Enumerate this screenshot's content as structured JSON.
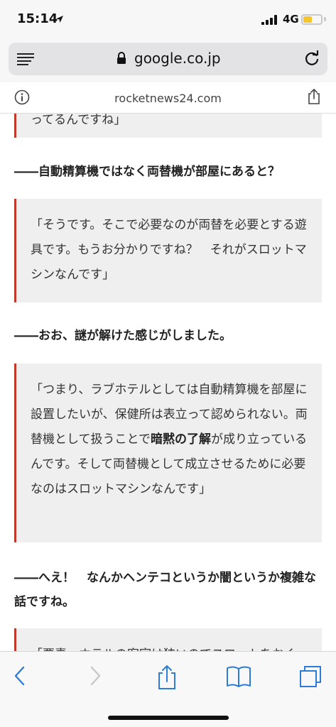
{
  "status_bar": {
    "time": "15:14",
    "network": "4G",
    "battery_level": 0.55,
    "battery_color": "#f5c52b"
  },
  "browser": {
    "url": "google.co.jp",
    "site": "rocketnews24.com",
    "icons": [
      "menu-icon",
      "lock-icon",
      "reload-icon",
      "info-icon",
      "share-icon"
    ]
  },
  "article": {
    "partial_top": "ってるんですね」",
    "q1": "――自動精算機ではなく両替機が部屋にあると？",
    "a1": "「そうです。そこで必要なのが両替を必要とする遊具です。もうお分かりですね？　それがスロットマシンなんです」",
    "q2": "――おお、謎が解けた感じがしました。",
    "a2_part1": "「つまり、ラブホテルとしては自動精算機を部屋に設置したいが、保健所は表立って認められない。両替機として扱うことで",
    "a2_bold": "暗黙の了解",
    "a2_part2": "が成り立っているんです。そして両替機として成立させるために必要なのはスロットマシンなんです」",
    "q3": "――へえ！　なんかヘンテコというか闇というか複雑な話ですね。",
    "partial_bottom": "「要素、ホテルの客室は狭いのでスロットをおく",
    "accent_color": "#c0392b"
  },
  "toolbar": {
    "icons": [
      "back-icon",
      "forward-icon",
      "share-icon",
      "bookmarks-icon",
      "tabs-icon"
    ],
    "accent_color": "#2f7bd8"
  }
}
